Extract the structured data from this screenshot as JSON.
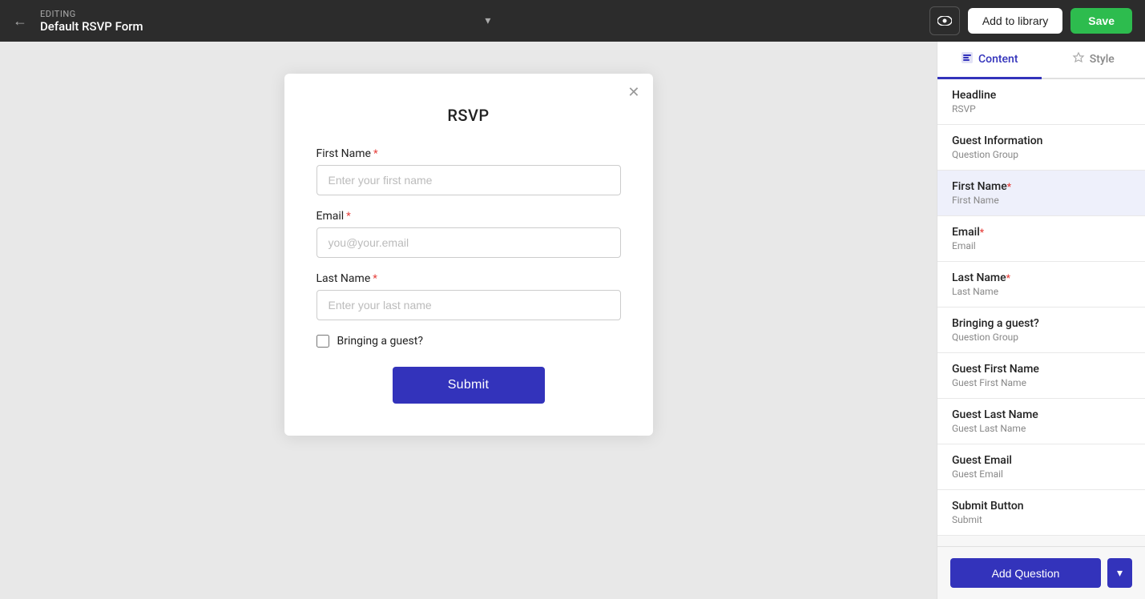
{
  "topbar": {
    "editing_label": "EDITING",
    "title": "Default RSVP Form",
    "back_icon": "←",
    "chevron_icon": "▾",
    "eye_icon": "👁",
    "library_label": "Add to library",
    "save_label": "Save"
  },
  "form": {
    "title": "RSVP",
    "close_icon": "✕",
    "fields": [
      {
        "label": "First Name",
        "required": true,
        "placeholder": "Enter your first name",
        "type": "text"
      },
      {
        "label": "Email",
        "required": true,
        "placeholder": "you@your.email",
        "type": "email"
      },
      {
        "label": "Last Name",
        "required": true,
        "placeholder": "Enter your last name",
        "type": "text"
      }
    ],
    "checkbox_label": "Bringing a guest?",
    "submit_label": "Submit"
  },
  "sidebar": {
    "tabs": [
      {
        "label": "Content",
        "active": true
      },
      {
        "label": "Style",
        "active": false
      }
    ],
    "content_icon": "⬜",
    "style_icon": "◇",
    "items": [
      {
        "title": "Headline",
        "subtitle": "RSVP",
        "required": false
      },
      {
        "title": "Guest Information",
        "subtitle": "Question Group",
        "required": false
      },
      {
        "title": "First Name",
        "subtitle": "First Name",
        "required": true,
        "active": true
      },
      {
        "title": "Email",
        "subtitle": "Email",
        "required": true
      },
      {
        "title": "Last Name",
        "subtitle": "Last Name",
        "required": true
      },
      {
        "title": "Bringing a guest?",
        "subtitle": "Question Group",
        "required": false
      },
      {
        "title": "Guest First Name",
        "subtitle": "Guest First Name",
        "required": false
      },
      {
        "title": "Guest Last Name",
        "subtitle": "Guest Last Name",
        "required": false
      },
      {
        "title": "Guest Email",
        "subtitle": "Guest Email",
        "required": false
      },
      {
        "title": "Submit Button",
        "subtitle": "Submit",
        "required": false
      }
    ],
    "add_question_label": "Add Question"
  }
}
